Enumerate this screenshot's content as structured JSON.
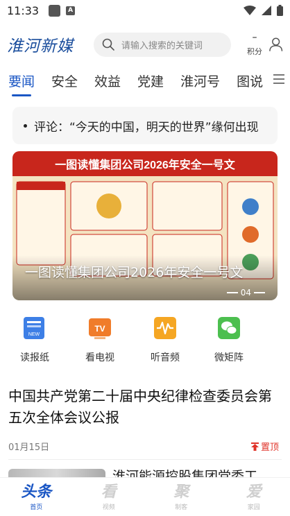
{
  "status_bar": {
    "time": "11:33",
    "app_badge": "A"
  },
  "header": {
    "logo": "淮河新媒",
    "search_placeholder": "请输入搜索的关键词",
    "points_value": "–",
    "points_label": "积分"
  },
  "tabs": [
    "要闻",
    "安全",
    "效益",
    "党建",
    "淮河号",
    "图说"
  ],
  "ticker": {
    "text": "评论：“今天的中国，明天的世界”缘何出现"
  },
  "banner": {
    "image_title": "一图读懂集团公司2026年安全一号文",
    "caption": "一图读懂集团公司2026年安全一号文",
    "page": "04"
  },
  "quick_links": [
    {
      "label": "读报纸",
      "icon": "newspaper-icon",
      "color": "#3d7fe6"
    },
    {
      "label": "看电视",
      "icon": "tv-icon",
      "color": "#f07c2a"
    },
    {
      "label": "听音频",
      "icon": "audio-icon",
      "color": "#f5a623"
    },
    {
      "label": "微矩阵",
      "icon": "wechat-icon",
      "color": "#4cbf4f"
    }
  ],
  "article": {
    "title": "中国共产党第二十届中央纪律检查委员会第五次全体会议公报",
    "date": "01月15日",
    "pin_label": "置顶"
  },
  "next_article": {
    "title": "淮河能源控股集团党委工"
  },
  "bottom_nav": [
    {
      "main": "头条",
      "sub": "首页",
      "active": true
    },
    {
      "main": "看",
      "sub": "视频",
      "active": false
    },
    {
      "main": "聚",
      "sub": "制客",
      "active": false
    },
    {
      "main": "爱",
      "sub": "家园",
      "active": false
    }
  ],
  "colors": {
    "accent": "#1a56c4",
    "pin": "#e0342a",
    "logo": "#1a4d9c"
  }
}
